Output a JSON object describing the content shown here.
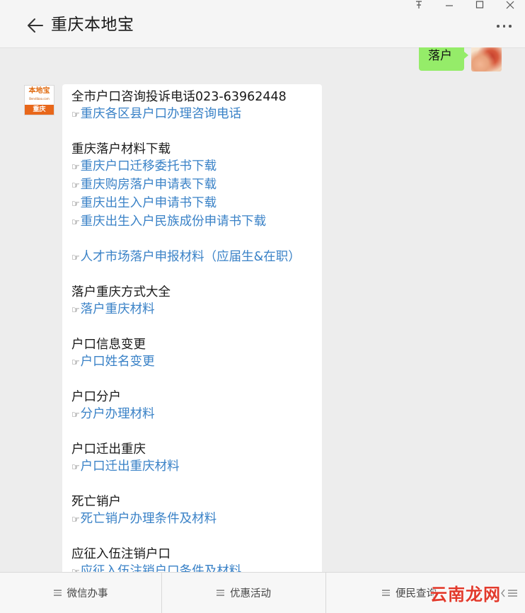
{
  "window": {
    "title": "重庆本地宝"
  },
  "sent_message": {
    "text": "落户"
  },
  "bot_avatar": {
    "logo_text": "本地宝",
    "logo_sub": "Bendibao.com",
    "city": "重庆"
  },
  "message_lines": [
    {
      "text": "全市户口咨询投诉电话023-63962448",
      "link": false
    },
    {
      "text": "重庆各区县户口办理咨询电话",
      "link": true
    },
    {
      "gap": true
    },
    {
      "text": "重庆落户材料下载",
      "link": false
    },
    {
      "text": "重庆户口迁移委托书下载",
      "link": true
    },
    {
      "text": "重庆购房落户申请表下载",
      "link": true
    },
    {
      "text": "重庆出生入户申请书下载",
      "link": true
    },
    {
      "text": "重庆出生入户民族成份申请书下载",
      "link": true
    },
    {
      "gap": true
    },
    {
      "text": "人才市场落户申报材料（应届生&在职）",
      "link": true
    },
    {
      "gap": true
    },
    {
      "text": "落户重庆方式大全",
      "link": false
    },
    {
      "text": "落户重庆材料",
      "link": true
    },
    {
      "gap": true
    },
    {
      "text": "户口信息变更",
      "link": false
    },
    {
      "text": "户口姓名变更",
      "link": true
    },
    {
      "gap": true
    },
    {
      "text": "户口分户",
      "link": false
    },
    {
      "text": "分户办理材料",
      "link": true
    },
    {
      "gap": true
    },
    {
      "text": "户口迁出重庆",
      "link": false
    },
    {
      "text": "户口迁出重庆材料",
      "link": true
    },
    {
      "gap": true
    },
    {
      "text": "死亡销户",
      "link": false
    },
    {
      "text": "死亡销户办理条件及材料",
      "link": true
    },
    {
      "gap": true
    },
    {
      "text": "应征入伍注销户口",
      "link": false
    },
    {
      "text": "应征入伍注销户口条件及材料",
      "link": true
    }
  ],
  "hand_glyph": "☞",
  "bottom_menu": [
    {
      "label": "微信办事"
    },
    {
      "label": "优惠活动"
    },
    {
      "label": "便民查询"
    }
  ],
  "watermark": "云南龙网",
  "colors": {
    "link": "#3a82c7",
    "sent_bubble": "#95ec69",
    "background": "#ededed",
    "brand_orange": "#e8671a"
  },
  "icons": {
    "back": "arrow-left-icon",
    "more": "more-dots-icon",
    "pin": "pin-icon",
    "minimize": "minimize-icon",
    "maximize": "maximize-icon",
    "close": "close-icon",
    "menu": "menu-lines-icon",
    "keyboard": "keyboard-toggle-icon"
  }
}
